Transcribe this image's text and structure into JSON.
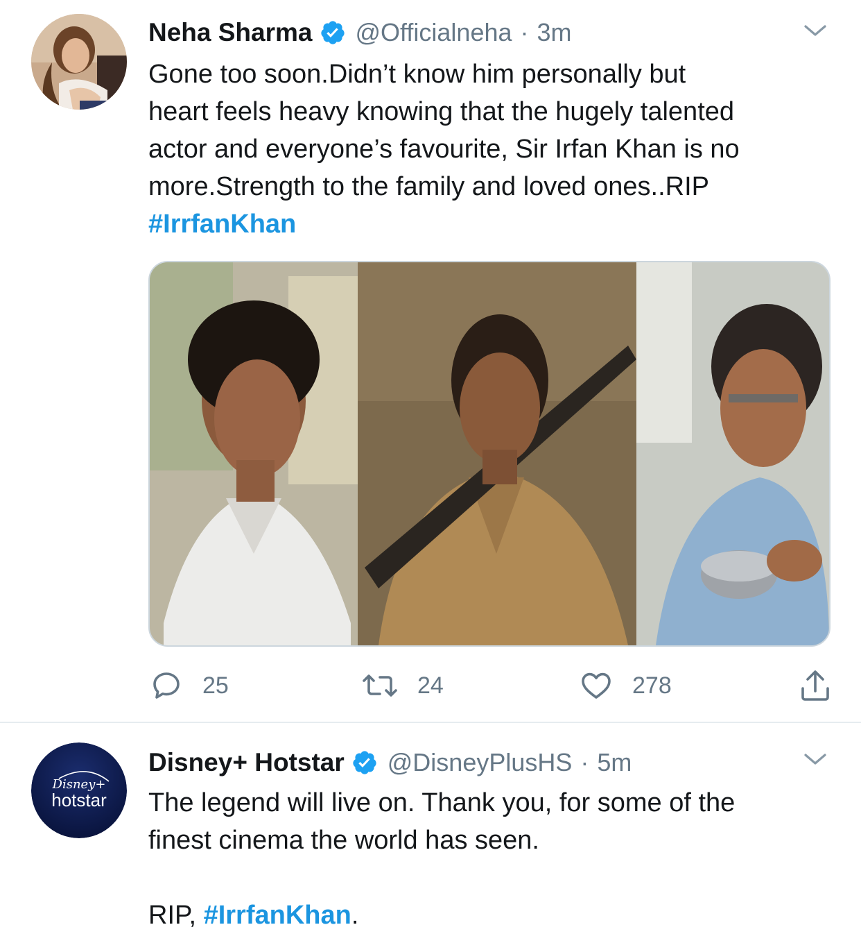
{
  "tweets": [
    {
      "author_name": "Neha Sharma",
      "verified": true,
      "handle": "@Officialneha",
      "separator": "·",
      "time": "3m",
      "text_lines": [
        "Gone too soon.Didn’t know him personally but",
        "heart feels heavy knowing that the hugely talented",
        "actor and everyone’s favourite, Sir Irfan Khan is no",
        "more.Strength to the family and loved ones..RIP"
      ],
      "hashtag": "#IrrfanKhan",
      "actions": {
        "replies": "25",
        "retweets": "24",
        "likes": "278"
      },
      "icons": [
        "reply-icon",
        "retweet-icon",
        "like-icon",
        "share-icon",
        "chevron-down-icon",
        "verified-badge-icon"
      ]
    },
    {
      "author_name": "Disney+ Hotstar",
      "verified": true,
      "handle": "@DisneyPlusHS",
      "separator": "·",
      "time": "5m",
      "text_lines": [
        "The legend will live on. Thank you, for some of the",
        "finest cinema the world has seen."
      ],
      "closing_prefix": "RIP, ",
      "hashtag": "#IrrfanKhan",
      "closing_suffix": ".",
      "avatar_logo": {
        "line1": "Disney+",
        "line2": "hotstar"
      }
    }
  ],
  "colors": {
    "accent": "#1DA1F2",
    "hashtag": "#1B95E0",
    "secondary_text": "#657786",
    "primary_text": "#14171A",
    "divider": "#E6ECF0",
    "hotstar_avatar_bg": "#0C1A4B"
  }
}
